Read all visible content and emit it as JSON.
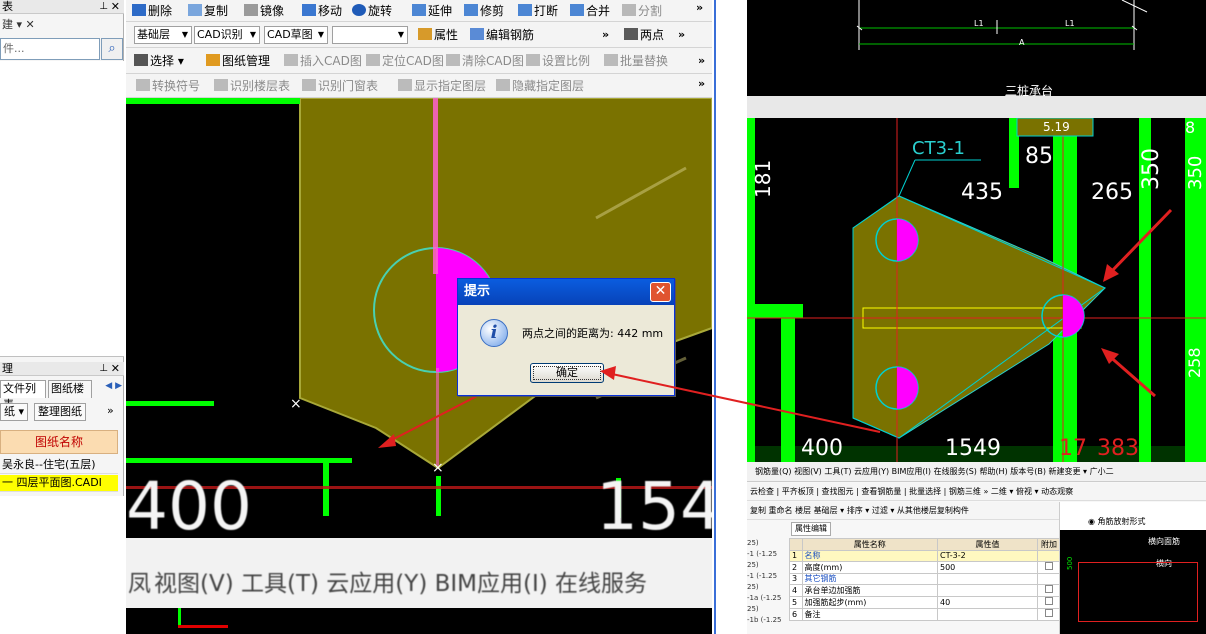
{
  "left_panel": {
    "top_header": "表",
    "top_bar": "建 ▾ ✕",
    "search_placeholder": "件...",
    "lower_header": "理",
    "tabs": [
      "文件列表",
      "图纸楼"
    ],
    "tool_buttons": [
      "纸 ▾",
      "整理图纸",
      "»"
    ],
    "grid_header": "图纸名称",
    "rows": [
      "吴永良--住宅(五层)",
      "一 四层平面图.CADI"
    ]
  },
  "toolbar1": {
    "items": [
      "删除",
      "复制",
      "镜像",
      "移动",
      "旋转",
      "延伸",
      "修剪",
      "打断",
      "合并",
      "分割"
    ],
    "more": "»"
  },
  "toolbar2": {
    "floor": "基础层",
    "cad_identify": "CAD识别",
    "cad_sketch": "CAD草图",
    "empty_combo": "",
    "property": "属性",
    "edit_rebar": "编辑钢筋",
    "two_points": "两点",
    "more": "»"
  },
  "toolbar3": {
    "select": "选择",
    "drawing_mgmt": "图纸管理",
    "insert_cad": "插入CAD图",
    "locate_cad": "定位CAD图",
    "clear_cad": "清除CAD图",
    "set_scale": "设置比例",
    "batch_replace": "批量替换",
    "more": "»"
  },
  "toolbar4": {
    "convert_symbol": "转换符号",
    "identify_floor_table": "识别楼层表",
    "identify_door_window": "识别门窗表",
    "show_layer": "显示指定图层",
    "hide_layer": "隐藏指定图层",
    "more": "»"
  },
  "viewport": {
    "big_number_left": "400",
    "big_number_right": "154",
    "bottom_menu": "视图(V)  工具(T)  云应用(Y)  BIM应用(I)  在线服务",
    "bottom_menu_lead": "凤"
  },
  "dialog": {
    "title": "提示",
    "icon": "i",
    "message": "两点之间的距离为: 442 mm",
    "ok_label": "确定"
  },
  "right_top": {
    "label_l1a": "L1",
    "label_l1b": "L1",
    "label_a": "A",
    "caption": "三桩承台"
  },
  "right_main": {
    "callout": "CT3-1",
    "dims": [
      "181",
      "85",
      "350",
      "350",
      "435",
      "265",
      "400",
      "1549",
      "17",
      "383",
      "5.19",
      "8"
    ],
    "marker": "258"
  },
  "right_bottom": {
    "menu": "钢筋量(Q)  视图(V)  工具(T)  云应用(Y)  BIM应用(I)  在线服务(S)  帮助(H)  版本号(B)   新建变更 ▾   广小二",
    "tb1": "云检查  |  平齐板顶  |  查找图元  |  查看钢筋量  |  批量选择  |  钢筋三维   »   二维 ▾  俯视 ▾  动态观察",
    "tb2": "复制  重命名  楼层 基础层  ▾  排序 ▾  过滤 ▾  从其他楼层复制构件",
    "prop_tab": "属性编辑",
    "prop_headers": [
      "",
      "属性名称",
      "属性值",
      "附加"
    ],
    "prop_rows": [
      [
        "1",
        "名称",
        "CT-3-2",
        ""
      ],
      [
        "2",
        "高度(mm)",
        "500",
        "chk"
      ],
      [
        "3",
        "其它钢筋",
        "",
        ""
      ],
      [
        "4",
        "承台单边加强筋",
        "",
        "chk"
      ],
      [
        "5",
        "加强筋起步(mm)",
        "40",
        "chk"
      ],
      [
        "6",
        "备注",
        "",
        "chk"
      ]
    ],
    "left_list": [
      "25)",
      "-1 (-1.25",
      "25)",
      "-1 (-1.25",
      "25)",
      "-1a (-1.25",
      "25)",
      "-1b (-1.25"
    ],
    "side_title": "◉ 角筋放射形式",
    "side_label": "横向面筋",
    "side_label2": "横向",
    "side_num": "500"
  },
  "colors": {
    "cad_fill": "#7a7200",
    "cad_green": "#00ff00",
    "magenta": "#ff00ff",
    "cyan": "#00d0d0",
    "red_arrow": "#e02020",
    "dialog_title": "#0a5ddf"
  }
}
